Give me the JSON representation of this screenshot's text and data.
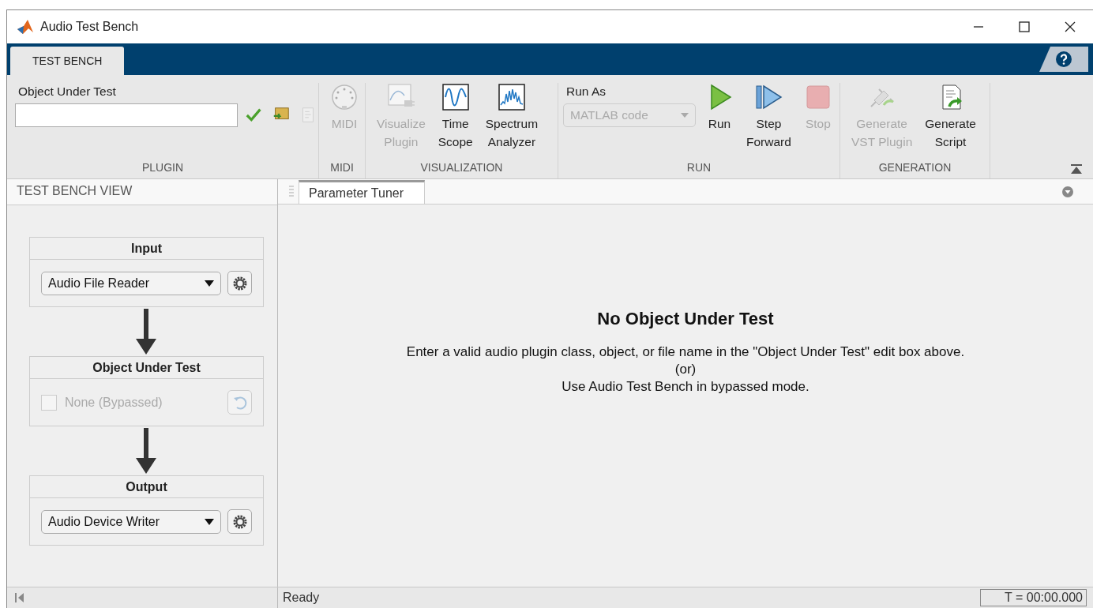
{
  "window": {
    "title": "Audio Test Bench"
  },
  "tabs": [
    {
      "label": "TEST BENCH",
      "selected": true
    }
  ],
  "ribbon": {
    "sections": [
      {
        "title": "PLUGIN",
        "items": [
          {
            "kind": "field_group",
            "label": "Object Under Test",
            "buttons": [
              {
                "disabled": false
              },
              {
                "disabled": false
              },
              {
                "disabled": true
              }
            ]
          }
        ]
      },
      {
        "title": "MIDI",
        "items": [
          {
            "kind": "large",
            "label": [
              "MIDI"
            ],
            "disabled": true
          }
        ]
      },
      {
        "title": "VISUALIZATION",
        "items": [
          {
            "kind": "large",
            "label": [
              "Visualize",
              "Plugin"
            ],
            "disabled": true
          },
          {
            "kind": "large",
            "label": [
              "Time",
              "Scope"
            ],
            "disabled": false
          },
          {
            "kind": "large",
            "label": [
              "Spectrum",
              "Analyzer"
            ],
            "disabled": false
          }
        ]
      },
      {
        "title": "RUN",
        "items": [
          {
            "kind": "dropdown",
            "label": "Run As",
            "value": "MATLAB code",
            "disabled": true
          },
          {
            "kind": "large",
            "label": [
              "Run"
            ],
            "disabled": false
          },
          {
            "kind": "large",
            "label": [
              "Step",
              "Forward"
            ],
            "disabled": false
          },
          {
            "kind": "large",
            "label": [
              "Stop"
            ],
            "disabled": true
          }
        ]
      },
      {
        "title": "GENERATION",
        "items": [
          {
            "kind": "large",
            "label": [
              "Generate",
              "VST Plugin"
            ],
            "disabled": true
          },
          {
            "kind": "large",
            "label": [
              "Generate",
              "Script"
            ],
            "disabled": false
          }
        ]
      }
    ]
  },
  "side_panel": {
    "title": "TEST BENCH VIEW",
    "blocks": [
      {
        "title": "Input",
        "kind": "dropdown",
        "value": "Audio File Reader"
      },
      {
        "title": "Object Under Test",
        "kind": "checkbox",
        "label": "None (Bypassed)",
        "checked": false,
        "disabled": true
      },
      {
        "title": "Output",
        "kind": "dropdown",
        "value": "Audio Device Writer"
      }
    ]
  },
  "document_tabs": [
    {
      "label": "Parameter Tuner",
      "selected": true
    }
  ],
  "message": {
    "heading": "No Object Under Test",
    "lines": [
      "Enter a valid audio plugin class, object, or file name in the \"Object Under Test\" edit box above.",
      "(or)",
      "Use Audio Test Bench in bypassed mode."
    ]
  },
  "status_bar": {
    "text": "Ready",
    "time": "T = 00:00.000"
  }
}
